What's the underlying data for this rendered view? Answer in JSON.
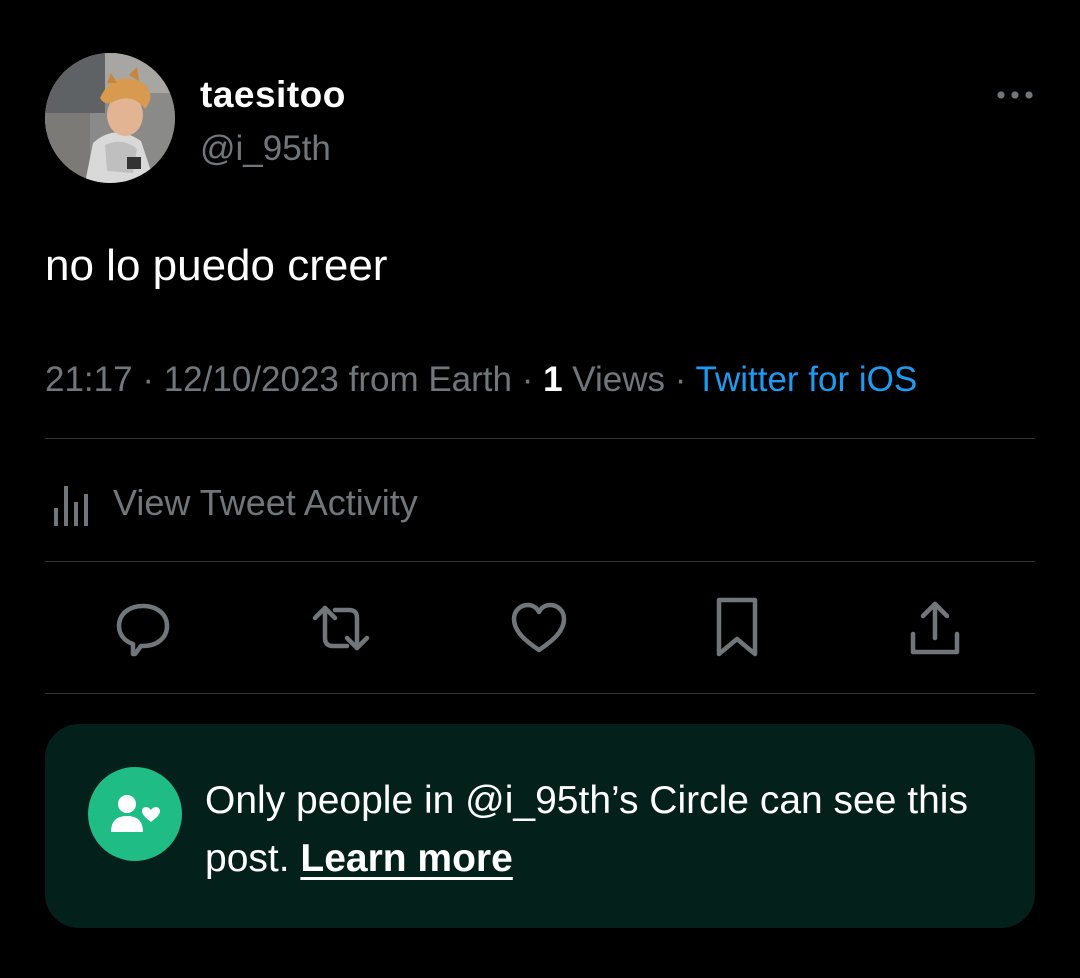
{
  "author": {
    "display_name": "taesitoo",
    "handle": "@i_95th",
    "avatar_icon": "profile-photo"
  },
  "tweet": {
    "text": "no lo puedo creer"
  },
  "meta": {
    "time": "21:17",
    "date_location": "12/10/2023 from Earth",
    "views_count": "1",
    "views_label": "Views",
    "client": "Twitter for iOS",
    "separator": " · "
  },
  "activity": {
    "label": "View Tweet Activity",
    "icon": "bar-chart-icon"
  },
  "actions": [
    {
      "name": "reply",
      "icon": "reply-icon"
    },
    {
      "name": "retweet",
      "icon": "retweet-icon"
    },
    {
      "name": "like",
      "icon": "heart-icon"
    },
    {
      "name": "bookmark",
      "icon": "bookmark-icon"
    },
    {
      "name": "share",
      "icon": "share-icon"
    }
  ],
  "circle_notice": {
    "text": "Only people in @i_95th’s Circle can see this post. ",
    "link": "Learn more",
    "icon": "circle-people-icon"
  },
  "colors": {
    "background": "#000000",
    "text_primary": "#ffffff",
    "text_secondary": "#71767b",
    "link": "#1d9bf0",
    "divider": "#2f3336",
    "circle_bg": "#04201a",
    "circle_accent": "#1fbc86"
  }
}
